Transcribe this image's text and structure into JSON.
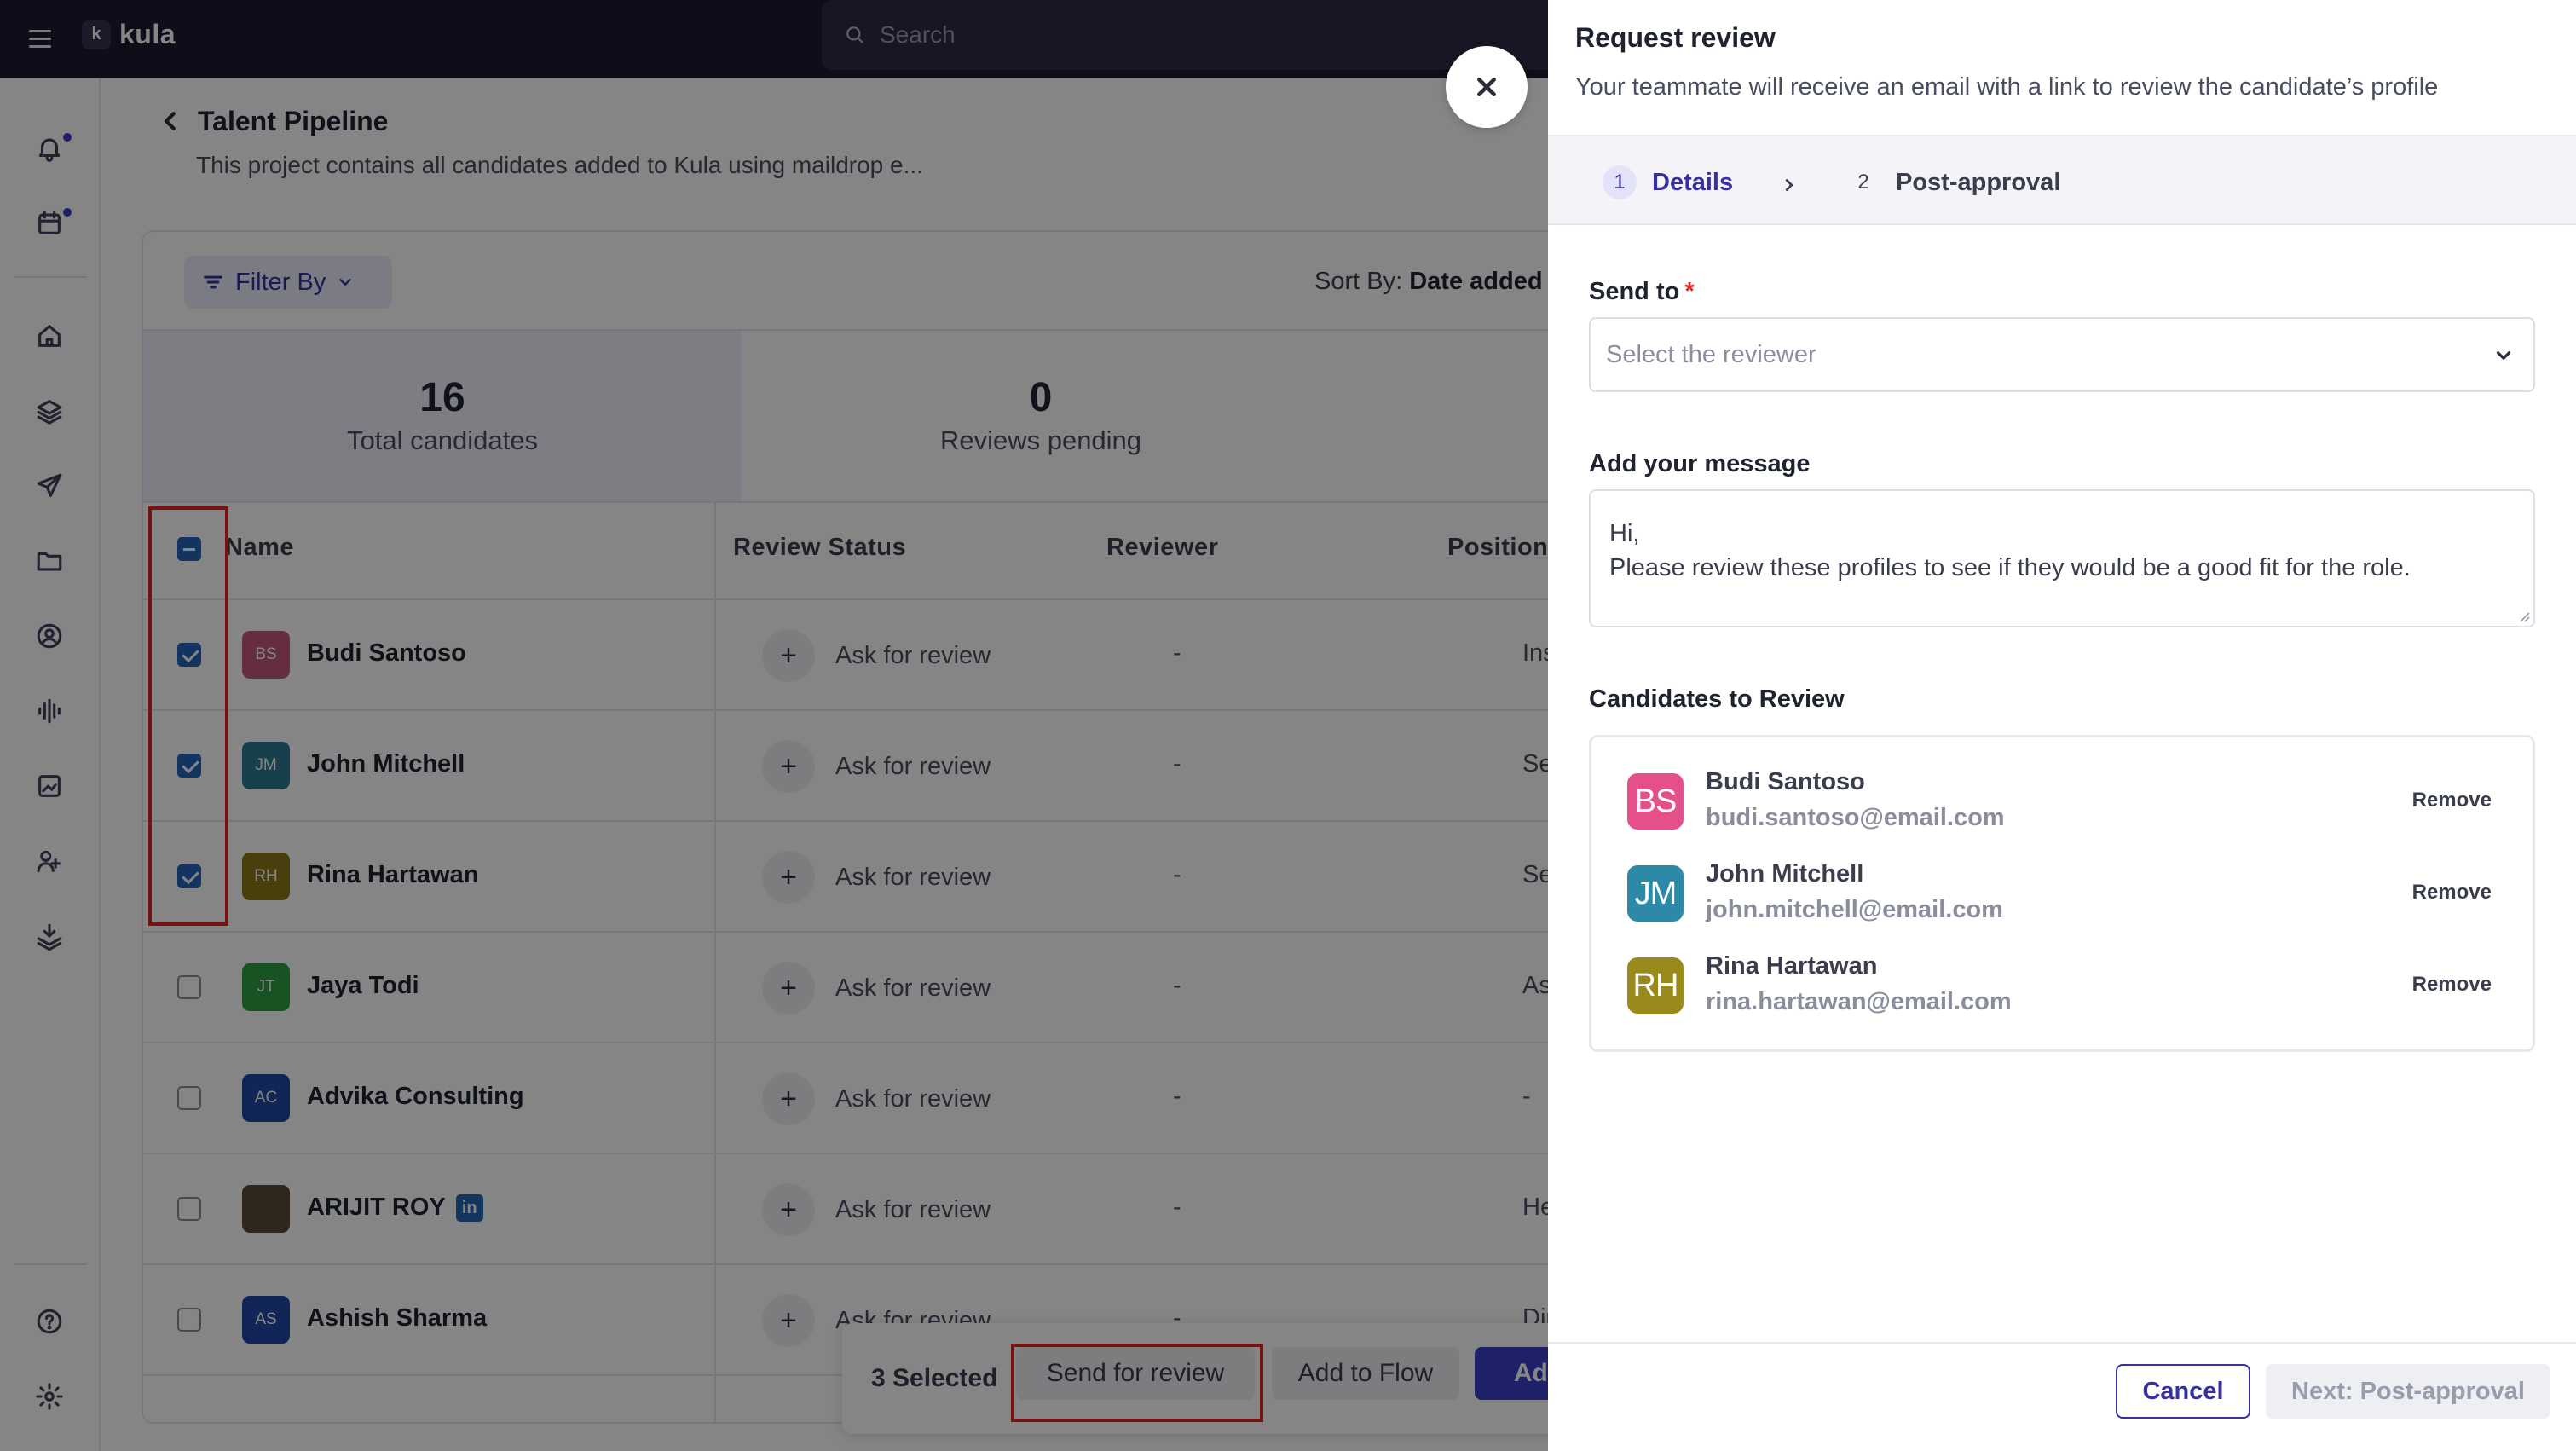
{
  "app": {
    "name": "kula",
    "logo_letter": "k"
  },
  "search": {
    "placeholder": "Search"
  },
  "sidebar": {
    "icons": [
      "bell-icon",
      "calendar-icon",
      "home-icon",
      "layers-icon",
      "send-icon",
      "folder-icon",
      "user-circle-icon",
      "audio-wave-icon",
      "image-chart-icon",
      "users-icon",
      "download-stack-icon",
      "help-icon",
      "settings-icon"
    ]
  },
  "page": {
    "title": "Talent Pipeline",
    "subtitle": "This project contains all candidates added to Kula using maildrop e..."
  },
  "toolbar": {
    "filter_label": "Filter By",
    "sort_prefix": "Sort By:",
    "sort_value": "Date added (Ne"
  },
  "stats": [
    {
      "value": "16",
      "label": "Total candidates"
    },
    {
      "value": "0",
      "label": "Reviews pending"
    }
  ],
  "table": {
    "columns": {
      "name": "Name",
      "review_status": "Review Status",
      "reviewer": "Reviewer",
      "position": "Position"
    },
    "rows": [
      {
        "initials": "BS",
        "name": "Budi Santoso",
        "review": "Ask for review",
        "reviewer": "-",
        "position": "Insinyur",
        "checked": true,
        "color": "#c2567f"
      },
      {
        "initials": "JM",
        "name": "John Mitchell",
        "review": "Ask for review",
        "reviewer": "-",
        "position": "Senior S",
        "checked": true,
        "color": "#2c7a92"
      },
      {
        "initials": "RH",
        "name": "Rina Hartawan",
        "review": "Ask for review",
        "reviewer": "-",
        "position": "Senior S",
        "checked": true,
        "color": "#8a7a1a"
      },
      {
        "initials": "JT",
        "name": "Jaya Todi",
        "review": "Ask for review",
        "reviewer": "-",
        "position": "Associat",
        "checked": false,
        "color": "#2ea043"
      },
      {
        "initials": "AC",
        "name": "Advika Consulting",
        "review": "Ask for review",
        "reviewer": "-",
        "position": "-",
        "checked": false,
        "color": "#2448a8"
      },
      {
        "initials": "",
        "name": "ARIJIT ROY",
        "review": "Ask for review",
        "reviewer": "-",
        "position": "Head Of",
        "checked": false,
        "color": "#5a4a3a",
        "linkedin": "in"
      },
      {
        "initials": "AS",
        "name": "Ashish Sharma",
        "review": "Ask for review",
        "reviewer": "-",
        "position": "Director",
        "checked": false,
        "color": "#2448a8"
      }
    ]
  },
  "bulk_bar": {
    "selected": "3 Selected",
    "send_review": "Send for review",
    "add_flow": "Add to Flow",
    "add": "Add"
  },
  "drawer": {
    "title": "Request review",
    "subtitle": "Your teammate will receive an email with a link to review the candidate’s profile",
    "steps": [
      {
        "num": "1",
        "label": "Details"
      },
      {
        "num": "2",
        "label": "Post-approval"
      }
    ],
    "send_to_label": "Send to",
    "required_mark": "*",
    "reviewer_placeholder": "Select the reviewer",
    "message_label": "Add your message",
    "message_line1": "Hi,",
    "message_line2": "Please review these profiles to see if they would be a good fit for the role.",
    "candidates_label": "Candidates to Review",
    "candidates": [
      {
        "initials": "BS",
        "name": "Budi Santoso",
        "email": "budi.santoso@email.com",
        "remove": "Remove",
        "color": "#e6508a"
      },
      {
        "initials": "JM",
        "name": "John Mitchell",
        "email": "john.mitchell@email.com",
        "remove": "Remove",
        "color": "#2c8aa8"
      },
      {
        "initials": "RH",
        "name": "Rina Hartawan",
        "email": "rina.hartawan@email.com",
        "remove": "Remove",
        "color": "#9a8a1c"
      }
    ],
    "cancel": "Cancel",
    "next": "Next: Post-approval"
  },
  "colors": {
    "accent": "#3730a3",
    "highlight": "#e02424",
    "topbar": "#1c1c33"
  }
}
